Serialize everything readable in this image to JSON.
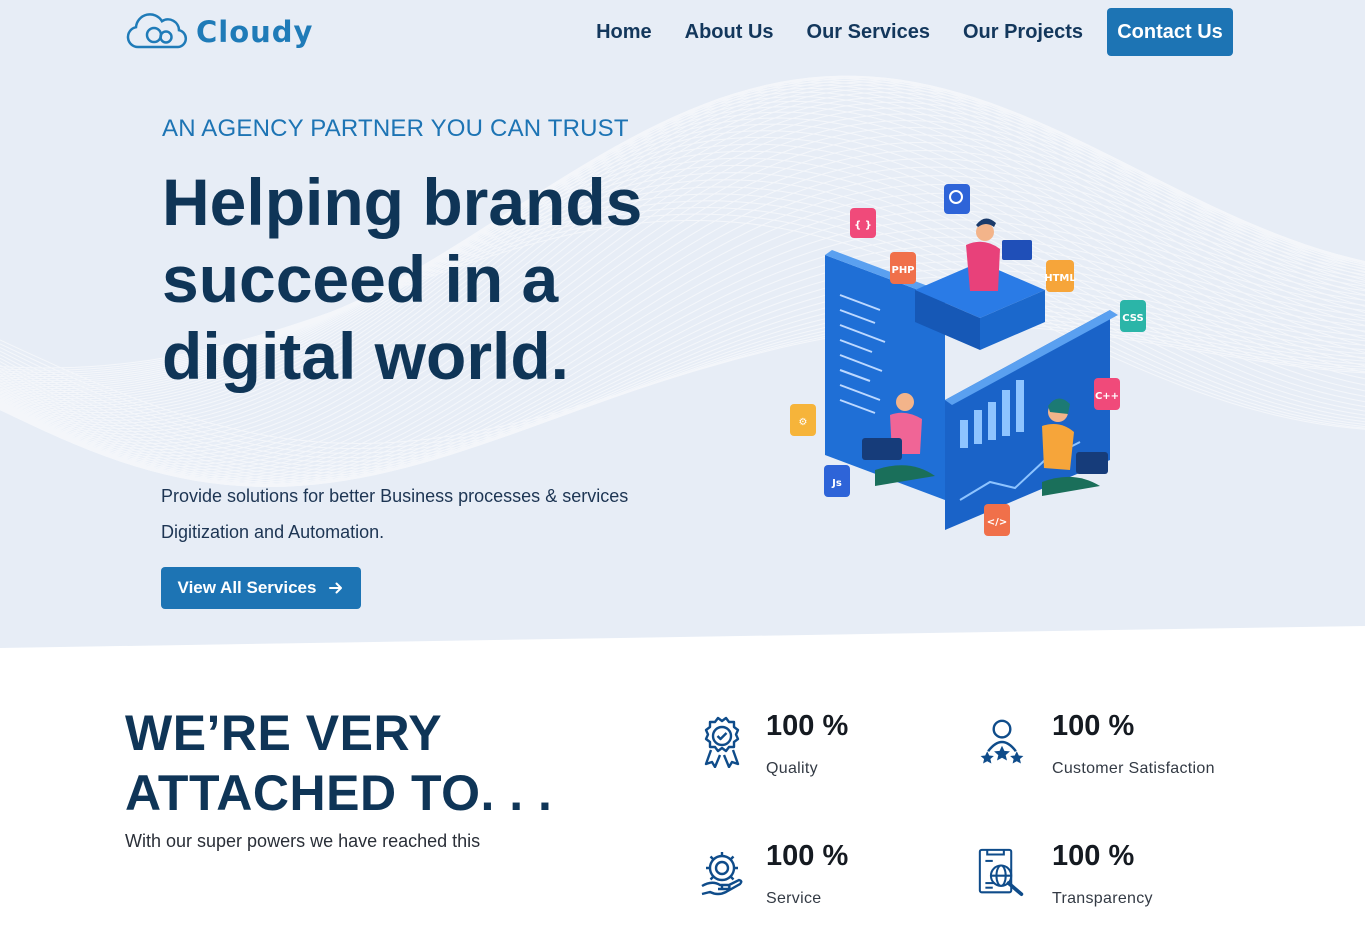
{
  "brand": {
    "name": "Cloudy",
    "accent": "#1d74b4",
    "dark": "#0f3557"
  },
  "nav": {
    "links": [
      "Home",
      "About Us",
      "Our Services",
      "Our Projects"
    ],
    "cta": "Contact Us"
  },
  "hero": {
    "eyebrow": "AN AGENCY PARTNER YOU CAN TRUST",
    "headline": "Helping brands succeed in a digital world.",
    "lede": "Provide solutions for better Business processes & services Digitization and Automation.",
    "button": "View All Services",
    "button_icon": "arrow-right-icon",
    "tech_badges": [
      "{ }",
      "PHP",
      "HTML",
      "CSS",
      "C++",
      "Js",
      "</>"
    ]
  },
  "attached": {
    "title_line1": "WE’RE VERY",
    "title_line2": "ATTACHED TO. . .",
    "subtitle": "With our super powers we have reached this",
    "stats": [
      {
        "value": "100 %",
        "label": "Quality",
        "icon": "award-badge-icon"
      },
      {
        "value": "100 %",
        "label": "Customer Satisfaction",
        "icon": "customer-stars-icon"
      },
      {
        "value": "100 %",
        "label": "Service",
        "icon": "service-gear-hand-icon"
      },
      {
        "value": "100 %",
        "label": "Transparency",
        "icon": "document-search-icon"
      }
    ]
  }
}
